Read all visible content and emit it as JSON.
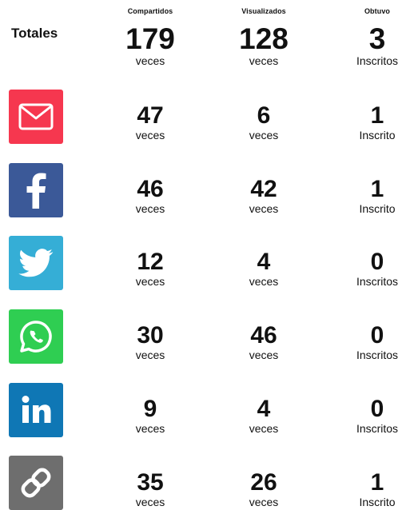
{
  "headers": {
    "shared": "Compartidos",
    "viewed": "Visualizados",
    "obtained": "Obtuvo"
  },
  "totals": {
    "label": "Totales",
    "shared": {
      "value": "179",
      "unit": "veces"
    },
    "viewed": {
      "value": "128",
      "unit": "veces"
    },
    "obtained": {
      "value": "3",
      "unit": "Inscritos"
    }
  },
  "rows": [
    {
      "channel_icon": "email-icon",
      "icon_color": "#f6374f",
      "shared": {
        "value": "47",
        "unit": "veces"
      },
      "viewed": {
        "value": "6",
        "unit": "veces"
      },
      "obtained": {
        "value": "1",
        "unit": "Inscrito"
      }
    },
    {
      "channel_icon": "facebook-icon",
      "icon_color": "#3b5998",
      "shared": {
        "value": "46",
        "unit": "veces"
      },
      "viewed": {
        "value": "42",
        "unit": "veces"
      },
      "obtained": {
        "value": "1",
        "unit": "Inscrito"
      }
    },
    {
      "channel_icon": "twitter-icon",
      "icon_color": "#35aed6",
      "shared": {
        "value": "12",
        "unit": "veces"
      },
      "viewed": {
        "value": "4",
        "unit": "veces"
      },
      "obtained": {
        "value": "0",
        "unit": "Inscritos"
      }
    },
    {
      "channel_icon": "whatsapp-icon",
      "icon_color": "#2fce52",
      "shared": {
        "value": "30",
        "unit": "veces"
      },
      "viewed": {
        "value": "46",
        "unit": "veces"
      },
      "obtained": {
        "value": "0",
        "unit": "Inscritos"
      }
    },
    {
      "channel_icon": "linkedin-icon",
      "icon_color": "#0f77b5",
      "shared": {
        "value": "9",
        "unit": "veces"
      },
      "viewed": {
        "value": "4",
        "unit": "veces"
      },
      "obtained": {
        "value": "0",
        "unit": "Inscritos"
      }
    },
    {
      "channel_icon": "link-icon",
      "icon_color": "#6e6e6e",
      "shared": {
        "value": "35",
        "unit": "veces"
      },
      "viewed": {
        "value": "26",
        "unit": "veces"
      },
      "obtained": {
        "value": "1",
        "unit": "Inscrito"
      }
    }
  ]
}
